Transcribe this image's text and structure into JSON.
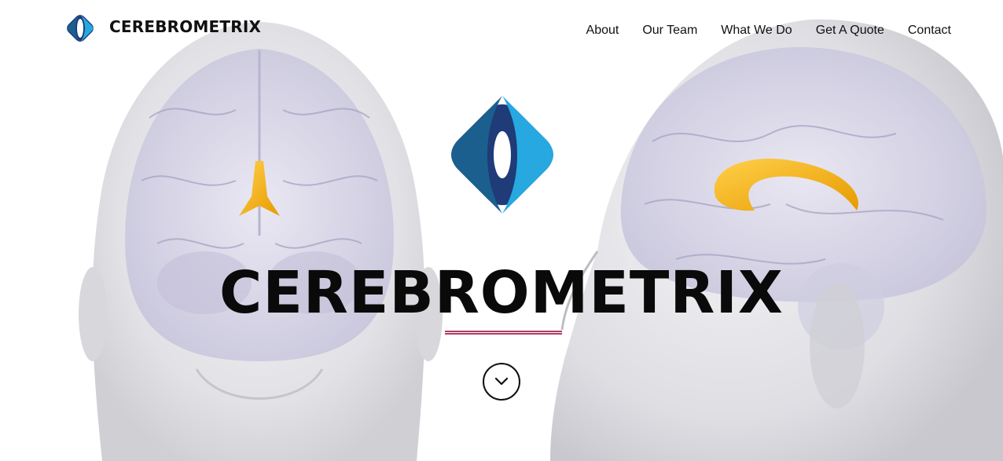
{
  "header": {
    "brand": "CEREBROMETRIX",
    "logo_icon": "diamond-logo-icon"
  },
  "nav": {
    "items": [
      {
        "label": "About"
      },
      {
        "label": "Our Team"
      },
      {
        "label": "What We Do"
      },
      {
        "label": "Get A Quote"
      },
      {
        "label": "Contact"
      }
    ]
  },
  "hero": {
    "title": "CEREBROMETRIX",
    "scroll_icon": "chevron-down-icon"
  },
  "colors": {
    "logo_dark": "#1f3b78",
    "logo_mid": "#1b5f8e",
    "logo_light": "#27a8e0",
    "accent_line": "#b33a63",
    "brain_highlight": "#f5b012"
  }
}
